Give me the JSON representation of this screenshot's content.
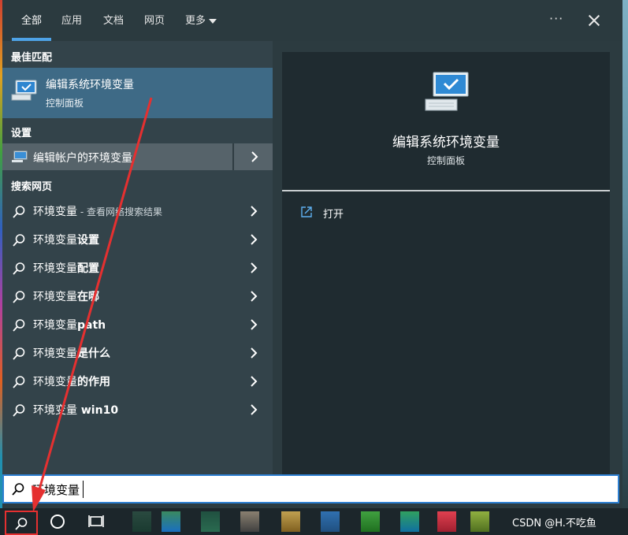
{
  "tabs": [
    {
      "label": "全部"
    },
    {
      "label": "应用"
    },
    {
      "label": "文档"
    },
    {
      "label": "网页"
    },
    {
      "label": "更多"
    }
  ],
  "more_options": "···",
  "sections": {
    "best_match": "最佳匹配",
    "settings": "设置",
    "web": "搜索网页"
  },
  "best_match": {
    "title": "编辑系统环境变量",
    "subtitle": "控制面板"
  },
  "settings_item": {
    "label": "编辑帐户的环境变量"
  },
  "web_items": [
    {
      "bold": "环境变量",
      "rest": "",
      "suffix": " - 查看网络搜索结果"
    },
    {
      "bold": "环境变量",
      "rest": "设置",
      "suffix": ""
    },
    {
      "bold": "环境变量",
      "rest": "配置",
      "suffix": ""
    },
    {
      "bold": "环境变量",
      "rest": "在哪",
      "suffix": ""
    },
    {
      "bold": "环境变量",
      "rest": "path",
      "suffix": ""
    },
    {
      "bold": "环境变量",
      "rest": "是什么",
      "suffix": ""
    },
    {
      "bold": "环境变量",
      "rest": "的作用",
      "suffix": ""
    },
    {
      "bold": "环境变量",
      "rest": " win10",
      "suffix": ""
    }
  ],
  "preview": {
    "title": "编辑系统环境变量",
    "subtitle": "控制面板",
    "open_label": "打开"
  },
  "search": {
    "value": "环境变量"
  },
  "watermark": "CSDN @H.不吃鱼",
  "colors": {
    "accent": "#4ea2e6",
    "selected_row": "#3e6a86",
    "annotation": "#e53030"
  }
}
